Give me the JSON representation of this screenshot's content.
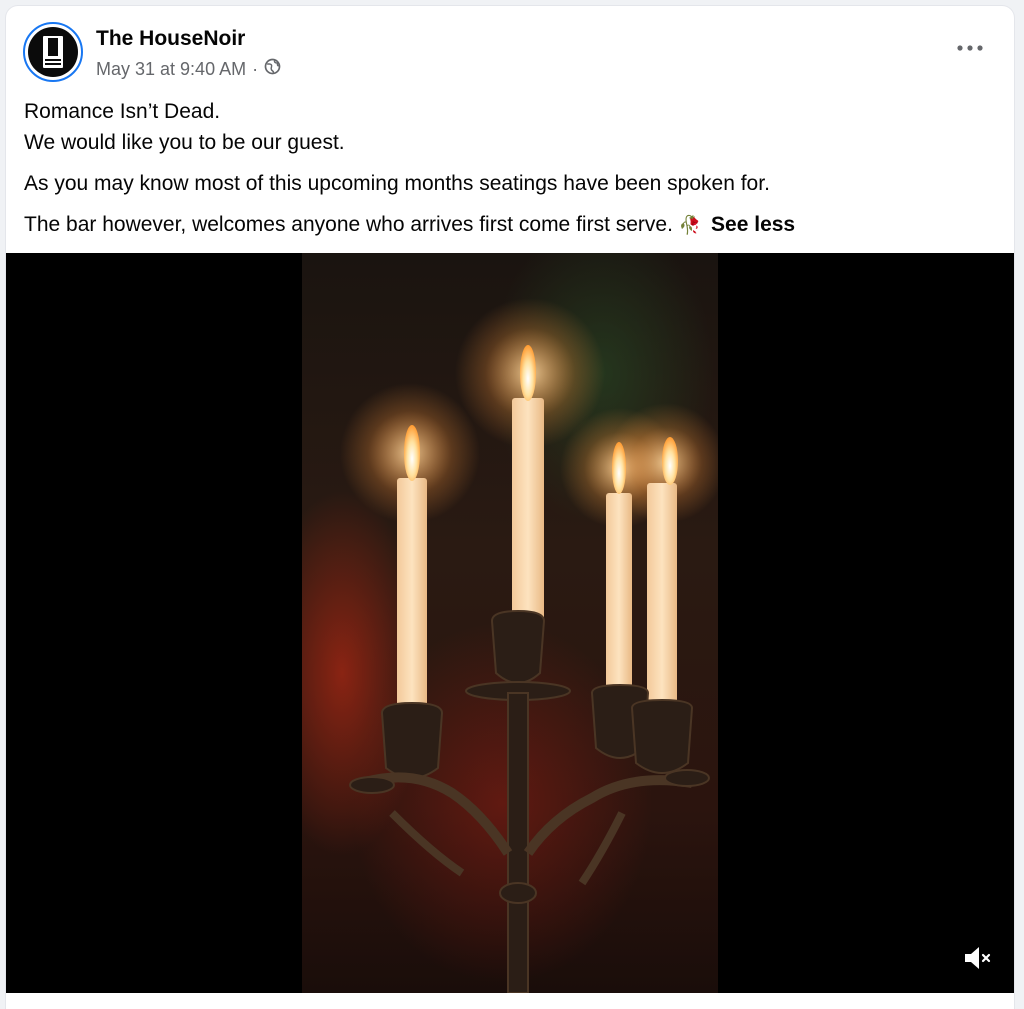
{
  "post": {
    "page_name": "The HouseNoir",
    "timestamp": "May 31 at 9:40 AM",
    "separator": "·",
    "audience_icon": "globe-icon",
    "more_icon": "more-options-icon",
    "text_lines": [
      "Romance Isn’t Dead.",
      "We would like you to be our guest.",
      "As you may know most of this upcoming months seatings have been spoken for.",
      "The bar however, welcomes anyone who arrives first come first serve."
    ],
    "emoji": "🥀",
    "see_less": "See less"
  },
  "video": {
    "subject": "candelabra-with-four-lit-candles",
    "mute_icon": "speaker-muted-icon"
  },
  "colors": {
    "accent": "#1877f2",
    "text_primary": "#050505",
    "text_secondary": "#65676b",
    "video_bg": "#000000"
  }
}
